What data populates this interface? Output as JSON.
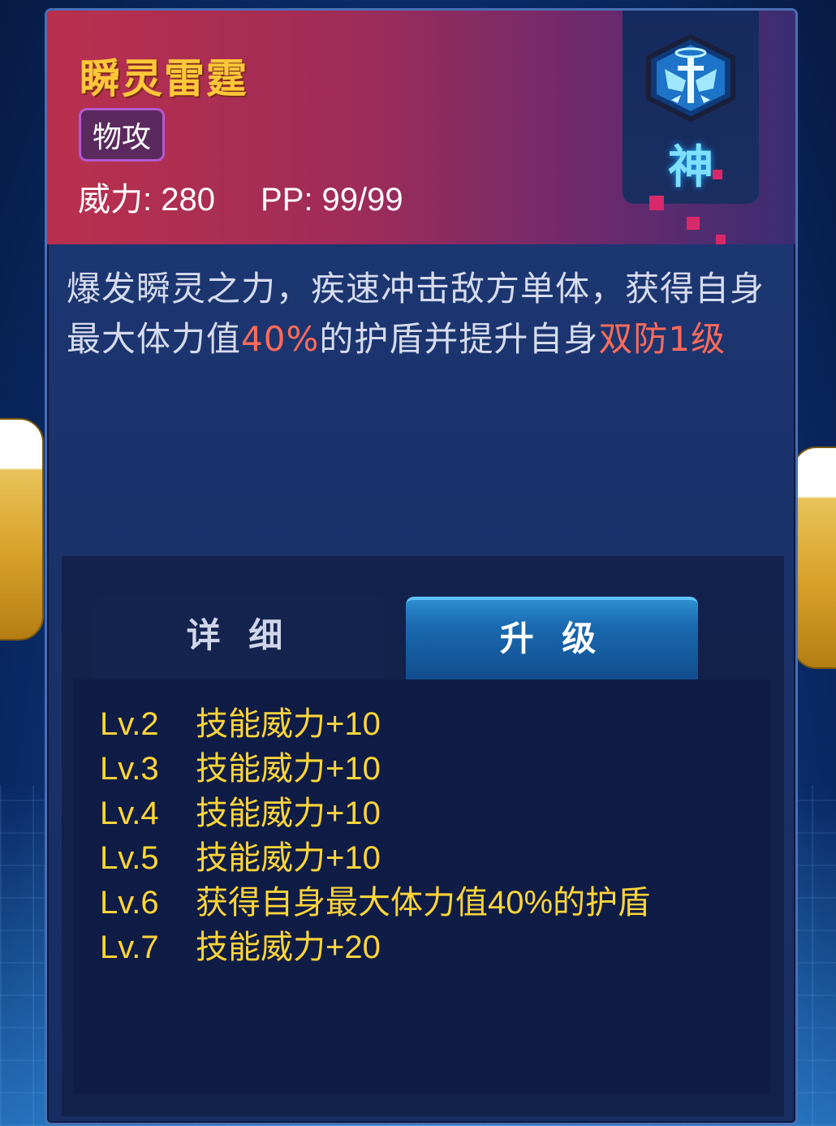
{
  "skill": {
    "name": "瞬灵雷霆",
    "category": "物攻",
    "power_label": "威力: 280",
    "pp_label": "PP: 99/99",
    "rank": "神"
  },
  "description": {
    "part1": "爆发瞬灵之力，疾速冲击敌方单体，获得自身最大体力值",
    "highlight1": "40%",
    "part2": "的护盾并提升自身",
    "highlight2": "双防1级"
  },
  "tabs": {
    "detail": "详 细",
    "upgrade": "升 级"
  },
  "upgrades": [
    {
      "level": "Lv.2",
      "effect": "技能威力+10"
    },
    {
      "level": "Lv.3",
      "effect": "技能威力+10"
    },
    {
      "level": "Lv.4",
      "effect": "技能威力+10"
    },
    {
      "level": "Lv.5",
      "effect": "技能威力+10"
    },
    {
      "level": "Lv.6",
      "effect": "获得自身最大体力值40%的护盾"
    },
    {
      "level": "Lv.7",
      "effect": "技能威力+20"
    }
  ],
  "colors": {
    "title": "#ffc83a",
    "highlight": "#ff6b5a",
    "upgrade_text": "#ffd53a",
    "rank": "#7fe0ff"
  },
  "icons": {
    "rank_emblem": "god-rank-emblem-icon"
  }
}
